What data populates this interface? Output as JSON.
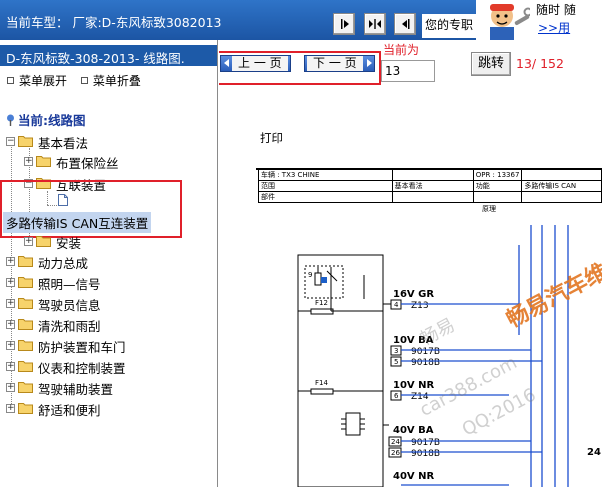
{
  "header": {
    "model_text": "当前车型：  厂家:D-东风标致3082013",
    "pro_text": "您的专职",
    "promo_line1": "随时 随",
    "promo_link": ">>用",
    "colors": {
      "bar": "#1f5bac",
      "accent": "#e0202a"
    }
  },
  "sidebar": {
    "doc_title": "D-东风标致-308-2013- 线路图.",
    "expand_label": "菜单展开",
    "collapse_label": "菜单折叠",
    "current_label": "当前:线路图",
    "tree": [
      {
        "label": "基本看法",
        "expanded": true
      },
      {
        "label": "布置保险丝",
        "expanded": false
      },
      {
        "label": "互联装置",
        "expanded": true
      },
      {
        "label": "多路传输IS CAN互连装置",
        "selected": true
      },
      {
        "label": "安装",
        "expanded": false
      },
      {
        "label": "动力总成",
        "expanded": false
      },
      {
        "label": "照明—信号",
        "expanded": false
      },
      {
        "label": "驾驶员信息",
        "expanded": false
      },
      {
        "label": "清洗和雨刮",
        "expanded": false
      },
      {
        "label": "防护装置和车门",
        "expanded": false
      },
      {
        "label": "仪表和控制装置",
        "expanded": false
      },
      {
        "label": "驾驶辅助装置",
        "expanded": false
      },
      {
        "label": "舒适和便利",
        "expanded": false
      }
    ]
  },
  "pager": {
    "prev_label": "上 一 页",
    "next_label": "下 一 页",
    "current_label": "当前为",
    "page_value": "13",
    "jump_label": "跳转",
    "page_count": "13/ 152"
  },
  "document": {
    "print_label": "打印",
    "header_table": [
      [
        "车辆 : TX3 CHINE",
        "",
        "OPR : 13367",
        ""
      ],
      [
        "范围",
        "基本看法",
        "功能",
        "多路传输IS CAN"
      ],
      [
        "部件",
        "",
        "",
        ""
      ]
    ],
    "principle_label": "原理",
    "wires": [
      {
        "label": "16V GR",
        "pins": [
          {
            "num": "4",
            "name": "Z13"
          }
        ]
      },
      {
        "label": "10V BA",
        "pins": [
          {
            "num": "3",
            "name": "9017B"
          },
          {
            "num": "5",
            "name": "9018B"
          }
        ]
      },
      {
        "label": "10V NR",
        "pins": [
          {
            "num": "6",
            "name": "Z14"
          }
        ]
      },
      {
        "label": "40V BA",
        "pins": [
          {
            "num": "24",
            "name": "9017B"
          },
          {
            "num": "26",
            "name": "9018B"
          }
        ]
      },
      {
        "label": "40V NR",
        "pins": []
      }
    ],
    "fuses": [
      "F12",
      "F14"
    ],
    "relay_number": "9",
    "right_edge_label": "24",
    "watermarks": [
      "畅易汽车维",
      "畅易",
      "car388.com",
      "QQ:2016"
    ]
  }
}
